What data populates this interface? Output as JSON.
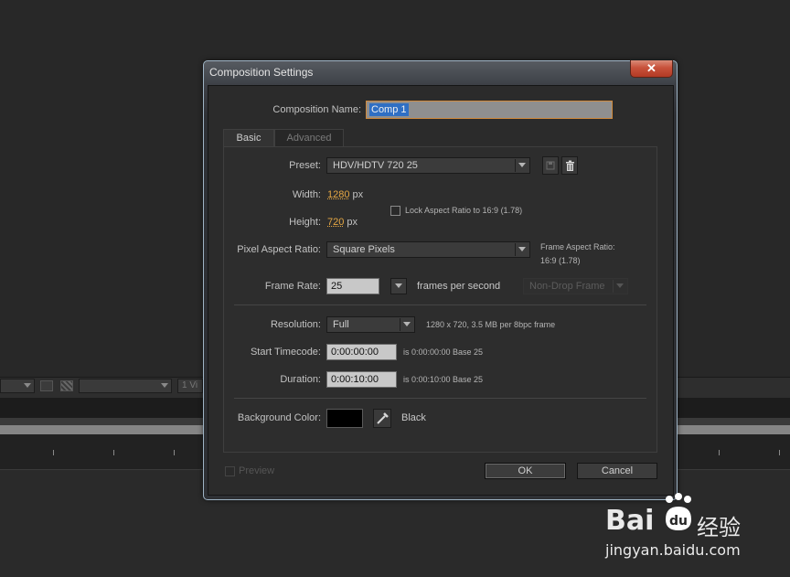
{
  "background_app": {
    "toolbar_label": "1 Vi"
  },
  "dialog": {
    "title": "Composition Settings",
    "close_glyph": "✕",
    "composition_name": {
      "label": "Composition Name:",
      "value": "Comp 1"
    },
    "tabs": [
      {
        "label": "Basic",
        "active": true
      },
      {
        "label": "Advanced",
        "active": false
      }
    ],
    "preset": {
      "label": "Preset:",
      "value": "HDV/HDTV 720 25",
      "save_icon": "save-preset-icon",
      "delete_icon": "trash-icon"
    },
    "width": {
      "label": "Width:",
      "value": "1280",
      "unit": "px"
    },
    "height": {
      "label": "Height:",
      "value": "720",
      "unit": "px"
    },
    "lock_aspect": {
      "label": "Lock Aspect Ratio to 16:9 (1.78)",
      "checked": false
    },
    "pixel_aspect": {
      "label": "Pixel Aspect Ratio:",
      "value": "Square Pixels"
    },
    "frame_aspect": {
      "label": "Frame Aspect Ratio:",
      "value": "16:9 (1.78)"
    },
    "frame_rate": {
      "label": "Frame Rate:",
      "value": "25",
      "unit": "frames per second",
      "drop_frame": "Non-Drop Frame"
    },
    "resolution": {
      "label": "Resolution:",
      "value": "Full",
      "info": "1280 x 720, 3.5 MB per 8bpc frame"
    },
    "start_timecode": {
      "label": "Start Timecode:",
      "value": "0:00:00:00",
      "info": "is 0:00:00:00  Base 25"
    },
    "duration": {
      "label": "Duration:",
      "value": "0:00:10:00",
      "info": "is 0:00:10:00  Base 25"
    },
    "background_color": {
      "label": "Background Color:",
      "swatch": "#000000",
      "name": "Black"
    },
    "preview": {
      "label": "Preview",
      "checked": false
    },
    "ok_label": "OK",
    "cancel_label": "Cancel"
  },
  "watermark": {
    "brand_left": "Bai",
    "brand_right": "经验",
    "url": "jingyan.baidu.com"
  },
  "colors": {
    "accent_orange": "#e6a844",
    "selection_blue": "#2f6fc4",
    "close_red": "#c8523b"
  }
}
